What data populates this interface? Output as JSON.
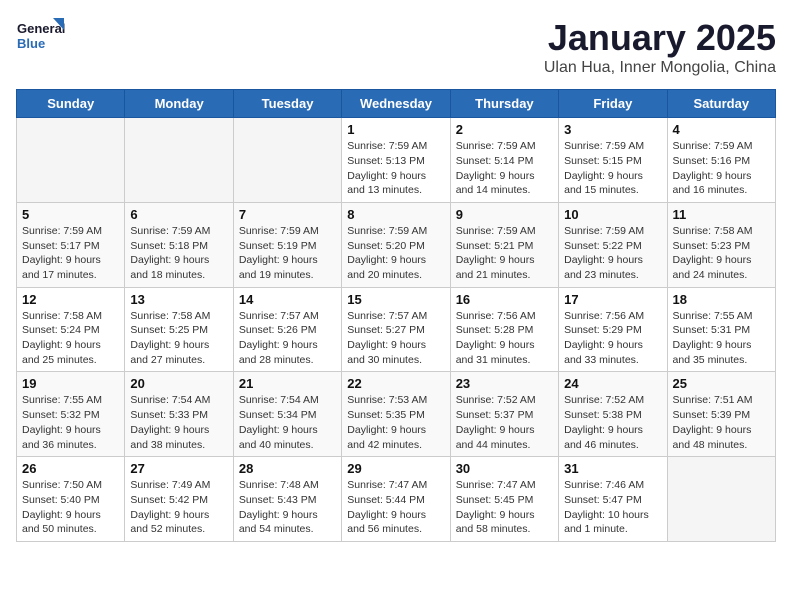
{
  "logo": {
    "line1": "General",
    "line2": "Blue"
  },
  "title": "January 2025",
  "subtitle": "Ulan Hua, Inner Mongolia, China",
  "weekdays": [
    "Sunday",
    "Monday",
    "Tuesday",
    "Wednesday",
    "Thursday",
    "Friday",
    "Saturday"
  ],
  "weeks": [
    [
      {
        "day": "",
        "info": ""
      },
      {
        "day": "",
        "info": ""
      },
      {
        "day": "",
        "info": ""
      },
      {
        "day": "1",
        "info": "Sunrise: 7:59 AM\nSunset: 5:13 PM\nDaylight: 9 hours\nand 13 minutes."
      },
      {
        "day": "2",
        "info": "Sunrise: 7:59 AM\nSunset: 5:14 PM\nDaylight: 9 hours\nand 14 minutes."
      },
      {
        "day": "3",
        "info": "Sunrise: 7:59 AM\nSunset: 5:15 PM\nDaylight: 9 hours\nand 15 minutes."
      },
      {
        "day": "4",
        "info": "Sunrise: 7:59 AM\nSunset: 5:16 PM\nDaylight: 9 hours\nand 16 minutes."
      }
    ],
    [
      {
        "day": "5",
        "info": "Sunrise: 7:59 AM\nSunset: 5:17 PM\nDaylight: 9 hours\nand 17 minutes."
      },
      {
        "day": "6",
        "info": "Sunrise: 7:59 AM\nSunset: 5:18 PM\nDaylight: 9 hours\nand 18 minutes."
      },
      {
        "day": "7",
        "info": "Sunrise: 7:59 AM\nSunset: 5:19 PM\nDaylight: 9 hours\nand 19 minutes."
      },
      {
        "day": "8",
        "info": "Sunrise: 7:59 AM\nSunset: 5:20 PM\nDaylight: 9 hours\nand 20 minutes."
      },
      {
        "day": "9",
        "info": "Sunrise: 7:59 AM\nSunset: 5:21 PM\nDaylight: 9 hours\nand 21 minutes."
      },
      {
        "day": "10",
        "info": "Sunrise: 7:59 AM\nSunset: 5:22 PM\nDaylight: 9 hours\nand 23 minutes."
      },
      {
        "day": "11",
        "info": "Sunrise: 7:58 AM\nSunset: 5:23 PM\nDaylight: 9 hours\nand 24 minutes."
      }
    ],
    [
      {
        "day": "12",
        "info": "Sunrise: 7:58 AM\nSunset: 5:24 PM\nDaylight: 9 hours\nand 25 minutes."
      },
      {
        "day": "13",
        "info": "Sunrise: 7:58 AM\nSunset: 5:25 PM\nDaylight: 9 hours\nand 27 minutes."
      },
      {
        "day": "14",
        "info": "Sunrise: 7:57 AM\nSunset: 5:26 PM\nDaylight: 9 hours\nand 28 minutes."
      },
      {
        "day": "15",
        "info": "Sunrise: 7:57 AM\nSunset: 5:27 PM\nDaylight: 9 hours\nand 30 minutes."
      },
      {
        "day": "16",
        "info": "Sunrise: 7:56 AM\nSunset: 5:28 PM\nDaylight: 9 hours\nand 31 minutes."
      },
      {
        "day": "17",
        "info": "Sunrise: 7:56 AM\nSunset: 5:29 PM\nDaylight: 9 hours\nand 33 minutes."
      },
      {
        "day": "18",
        "info": "Sunrise: 7:55 AM\nSunset: 5:31 PM\nDaylight: 9 hours\nand 35 minutes."
      }
    ],
    [
      {
        "day": "19",
        "info": "Sunrise: 7:55 AM\nSunset: 5:32 PM\nDaylight: 9 hours\nand 36 minutes."
      },
      {
        "day": "20",
        "info": "Sunrise: 7:54 AM\nSunset: 5:33 PM\nDaylight: 9 hours\nand 38 minutes."
      },
      {
        "day": "21",
        "info": "Sunrise: 7:54 AM\nSunset: 5:34 PM\nDaylight: 9 hours\nand 40 minutes."
      },
      {
        "day": "22",
        "info": "Sunrise: 7:53 AM\nSunset: 5:35 PM\nDaylight: 9 hours\nand 42 minutes."
      },
      {
        "day": "23",
        "info": "Sunrise: 7:52 AM\nSunset: 5:37 PM\nDaylight: 9 hours\nand 44 minutes."
      },
      {
        "day": "24",
        "info": "Sunrise: 7:52 AM\nSunset: 5:38 PM\nDaylight: 9 hours\nand 46 minutes."
      },
      {
        "day": "25",
        "info": "Sunrise: 7:51 AM\nSunset: 5:39 PM\nDaylight: 9 hours\nand 48 minutes."
      }
    ],
    [
      {
        "day": "26",
        "info": "Sunrise: 7:50 AM\nSunset: 5:40 PM\nDaylight: 9 hours\nand 50 minutes."
      },
      {
        "day": "27",
        "info": "Sunrise: 7:49 AM\nSunset: 5:42 PM\nDaylight: 9 hours\nand 52 minutes."
      },
      {
        "day": "28",
        "info": "Sunrise: 7:48 AM\nSunset: 5:43 PM\nDaylight: 9 hours\nand 54 minutes."
      },
      {
        "day": "29",
        "info": "Sunrise: 7:47 AM\nSunset: 5:44 PM\nDaylight: 9 hours\nand 56 minutes."
      },
      {
        "day": "30",
        "info": "Sunrise: 7:47 AM\nSunset: 5:45 PM\nDaylight: 9 hours\nand 58 minutes."
      },
      {
        "day": "31",
        "info": "Sunrise: 7:46 AM\nSunset: 5:47 PM\nDaylight: 10 hours\nand 1 minute."
      },
      {
        "day": "",
        "info": ""
      }
    ]
  ]
}
